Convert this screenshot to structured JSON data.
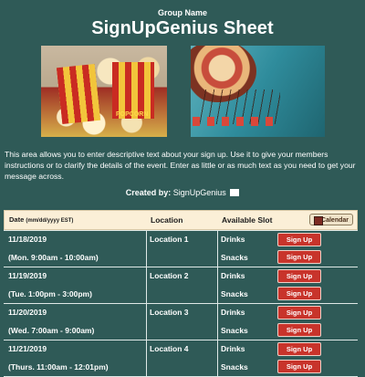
{
  "header": {
    "group_name": "Group Name",
    "title": "SignUpGenius Sheet"
  },
  "images": [
    {
      "name": "popcorn",
      "caption": "POPCORN"
    },
    {
      "name": "swing-carousel"
    }
  ],
  "description": "This area allows you to enter descriptive text about your sign up. Use it to give your members instructions or to clarify the details of the event. Enter as little or as much text as you need to get your message across.",
  "created_by": {
    "label": "Created by:",
    "name": "SignUpGenius",
    "icon": "envelope-icon"
  },
  "table": {
    "headers": {
      "date": "Date",
      "date_format": "(mm/dd/yyyy EST)",
      "location": "Location",
      "slot": "Available Slot",
      "calendar_button": "Calendar"
    },
    "rows": [
      {
        "date": "11/18/2019",
        "time": "(Mon. 9:00am - 10:00am)",
        "location": "Location 1",
        "slots": [
          "Drinks",
          "Snacks"
        ],
        "button": "Sign Up"
      },
      {
        "date": "11/19/2019",
        "time": "(Tue. 1:00pm - 3:00pm)",
        "location": "Location 2",
        "slots": [
          "Drinks",
          "Snacks"
        ],
        "button": "Sign Up"
      },
      {
        "date": "11/20/2019",
        "time": "(Wed. 7:00am - 9:00am)",
        "location": "Location 3",
        "slots": [
          "Drinks",
          "Snacks"
        ],
        "button": "Sign Up"
      },
      {
        "date": "11/21/2019",
        "time": "(Thurs. 11:00am - 12:01pm)",
        "location": "Location 4",
        "slots": [
          "Drinks",
          "Snacks"
        ],
        "button": "Sign Up"
      }
    ]
  },
  "colors": {
    "background": "#2f5a57",
    "header_row": "#fbefd7",
    "signup_button": "#c8342b"
  }
}
